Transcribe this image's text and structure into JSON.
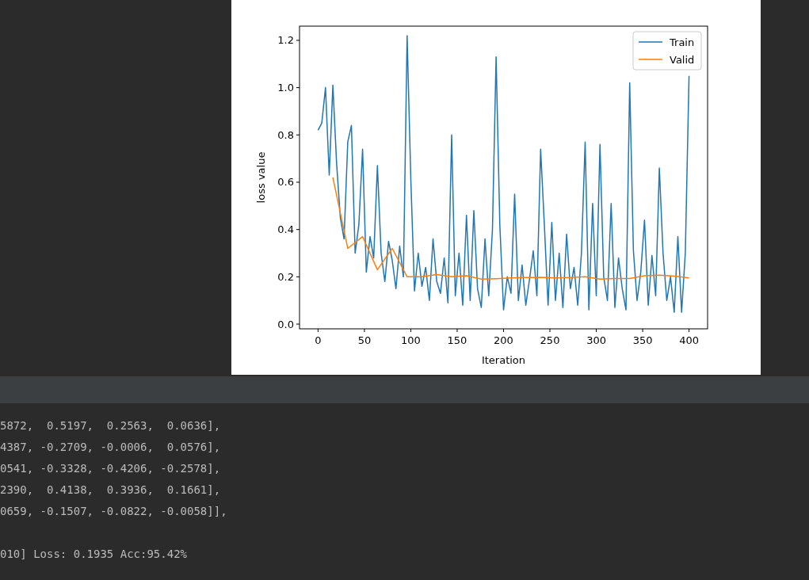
{
  "figure": {
    "chart_data": {
      "type": "line",
      "xlabel": "Iteration",
      "ylabel": "loss value",
      "x": [
        0,
        4,
        8,
        12,
        16,
        20,
        24,
        28,
        32,
        36,
        40,
        44,
        48,
        52,
        56,
        60,
        64,
        68,
        72,
        76,
        80,
        84,
        88,
        92,
        96,
        100,
        104,
        108,
        112,
        116,
        120,
        124,
        128,
        132,
        136,
        140,
        144,
        148,
        152,
        156,
        160,
        164,
        168,
        172,
        176,
        180,
        184,
        188,
        192,
        196,
        200,
        204,
        208,
        212,
        216,
        220,
        224,
        228,
        232,
        236,
        240,
        244,
        248,
        252,
        256,
        260,
        264,
        268,
        272,
        276,
        280,
        284,
        288,
        292,
        296,
        300,
        304,
        308,
        312,
        316,
        320,
        324,
        328,
        332,
        336,
        340,
        344,
        348,
        352,
        356,
        360,
        364,
        368,
        372,
        376,
        380,
        384,
        388,
        392,
        396,
        400
      ],
      "series": [
        {
          "name": "Train",
          "color": "#1f77b4",
          "values": [
            0.82,
            0.85,
            1.0,
            0.63,
            1.01,
            0.68,
            0.45,
            0.36,
            0.77,
            0.84,
            0.3,
            0.42,
            0.74,
            0.22,
            0.37,
            0.28,
            0.67,
            0.3,
            0.18,
            0.35,
            0.27,
            0.15,
            0.33,
            0.2,
            1.22,
            0.61,
            0.14,
            0.3,
            0.16,
            0.24,
            0.1,
            0.36,
            0.18,
            0.13,
            0.28,
            0.09,
            0.8,
            0.12,
            0.3,
            0.08,
            0.46,
            0.1,
            0.48,
            0.15,
            0.07,
            0.36,
            0.12,
            0.4,
            1.13,
            0.42,
            0.06,
            0.2,
            0.13,
            0.55,
            0.1,
            0.25,
            0.08,
            0.19,
            0.31,
            0.12,
            0.74,
            0.42,
            0.08,
            0.43,
            0.1,
            0.3,
            0.07,
            0.38,
            0.15,
            0.24,
            0.08,
            0.3,
            0.77,
            0.06,
            0.51,
            0.12,
            0.76,
            0.2,
            0.1,
            0.51,
            0.07,
            0.28,
            0.15,
            0.06,
            1.02,
            0.31,
            0.1,
            0.22,
            0.44,
            0.08,
            0.29,
            0.12,
            0.66,
            0.3,
            0.1,
            0.2,
            0.05,
            0.37,
            0.05,
            0.3,
            1.05
          ]
        },
        {
          "name": "Valid",
          "color": "#ff7f0e",
          "values": [
            null,
            null,
            null,
            null,
            0.62,
            null,
            null,
            null,
            0.32,
            null,
            null,
            null,
            0.37,
            null,
            null,
            null,
            0.23,
            null,
            null,
            null,
            0.32,
            null,
            null,
            null,
            0.2,
            null,
            null,
            null,
            0.2,
            null,
            null,
            null,
            0.21,
            null,
            null,
            null,
            0.2,
            null,
            null,
            null,
            0.205,
            null,
            null,
            null,
            0.19,
            null,
            null,
            null,
            0.192,
            null,
            null,
            null,
            0.195,
            null,
            null,
            null,
            0.197,
            null,
            null,
            null,
            0.198,
            null,
            null,
            null,
            0.195,
            null,
            null,
            null,
            0.197,
            null,
            null,
            null,
            0.2,
            null,
            null,
            null,
            0.19,
            null,
            null,
            null,
            0.193,
            null,
            null,
            null,
            0.193,
            null,
            null,
            null,
            0.205,
            null,
            null,
            null,
            0.207,
            null,
            null,
            null,
            0.203,
            null,
            null,
            null,
            0.195
          ]
        }
      ],
      "legend": "upper right",
      "xlim": [
        -20,
        420
      ],
      "ylim": [
        -0.02,
        1.26
      ],
      "xticks": [
        0,
        50,
        100,
        150,
        200,
        250,
        300,
        350,
        400
      ],
      "yticks": [
        {
          "value": 0,
          "label": "0.0"
        },
        {
          "value": 0.2,
          "label": "0.2"
        },
        {
          "value": 0.4,
          "label": "0.4"
        },
        {
          "value": 0.6,
          "label": "0.6"
        },
        {
          "value": 0.8,
          "label": "0.8"
        },
        {
          "value": 1.0,
          "label": "1.0"
        },
        {
          "value": 1.2,
          "label": "1.2"
        }
      ]
    }
  },
  "console": {
    "lines": [
      "5872,  0.5197,  0.2563,  0.0636],",
      "4387, -0.2709, -0.0006,  0.0576],",
      "0541, -0.3328, -0.4206, -0.2578],",
      "2390,  0.4138,  0.3936,  0.1661],",
      "0659, -0.1507, -0.0822, -0.0058]],"
    ],
    "status_line": "010] Loss: 0.1935 Acc:95.42%"
  }
}
